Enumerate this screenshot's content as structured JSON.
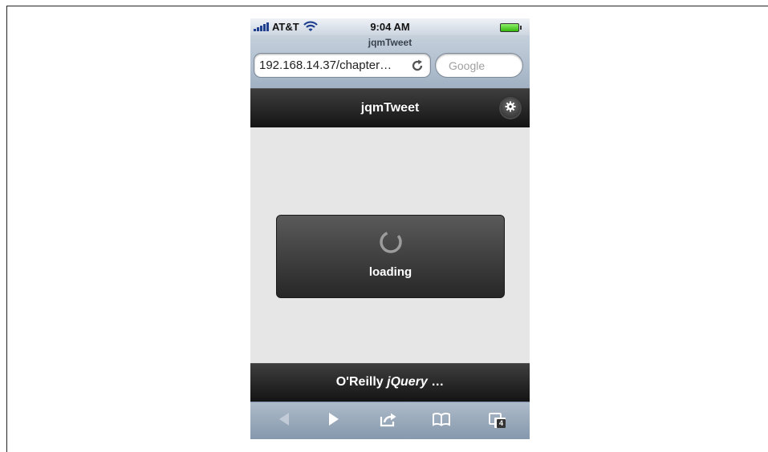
{
  "status_bar": {
    "carrier": "AT&T",
    "time": "9:04 AM"
  },
  "browser": {
    "page_title": "jqmTweet",
    "url": "192.168.14.37/chapter…",
    "search_placeholder": "Google"
  },
  "header": {
    "title": "jqmTweet"
  },
  "loader": {
    "text": "loading"
  },
  "footer": {
    "text_prefix": "O'Reilly ",
    "text_emphasis": "jQuery",
    "text_suffix": " …"
  },
  "toolbar": {
    "tabs_count": "4"
  },
  "colors": {
    "header_bg": "#1e1e1e",
    "content_bg": "#e6e6e6",
    "toolbar_bg": "#9aa9ba",
    "battery": "#4ccb1f"
  },
  "icons": [
    "signal-icon",
    "wifi-icon",
    "battery-icon",
    "reload-icon",
    "gear-icon",
    "spinner-icon",
    "back-icon",
    "forward-icon",
    "share-icon",
    "bookmarks-icon",
    "tabs-icon"
  ]
}
